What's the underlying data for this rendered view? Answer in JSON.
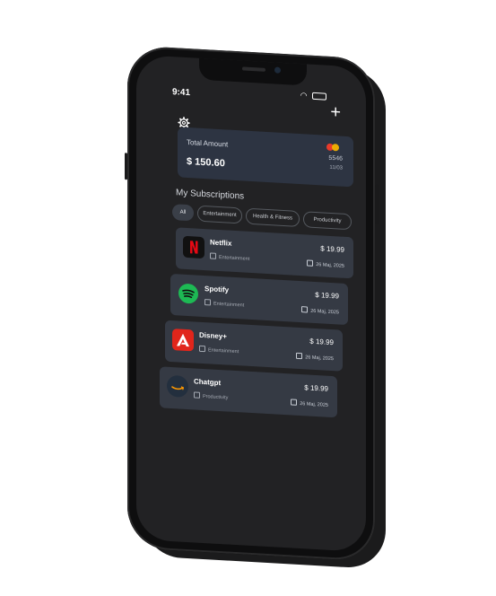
{
  "status": {
    "time": "9:41"
  },
  "header": {
    "add_label": "+"
  },
  "total": {
    "label": "Total Amount",
    "amount": "$ 150.60",
    "card_number": "5546",
    "expiry": "11/03",
    "colors": {
      "mc_left": "#e93a2a",
      "mc_right": "#f6b200"
    }
  },
  "section_title": "My Subscriptions",
  "filters": [
    "All",
    "Entertainment",
    "Health & Fitness",
    "Productivity"
  ],
  "active_filter": "All",
  "subscriptions": [
    {
      "name": "Netflix",
      "category": "Entertainment",
      "price": "$ 19.99",
      "date": "26 Maj, 2025",
      "icon": "netflix-logo",
      "color": "#e50914"
    },
    {
      "name": "Spotify",
      "category": "Entertainment",
      "price": "$ 19.99",
      "date": "26 Maj, 2025",
      "icon": "spotify-logo",
      "color": "#1db954"
    },
    {
      "name": "Disney+",
      "category": "Entertainment",
      "price": "$ 19.99",
      "date": "26 Maj, 2025",
      "icon": "adobe-logo",
      "color": "#e1251b"
    },
    {
      "name": "Chatgpt",
      "category": "Productivity",
      "price": "$ 19.99",
      "date": "26 Maj, 2025",
      "icon": "amazon-logo",
      "color": "#232f3e"
    }
  ]
}
